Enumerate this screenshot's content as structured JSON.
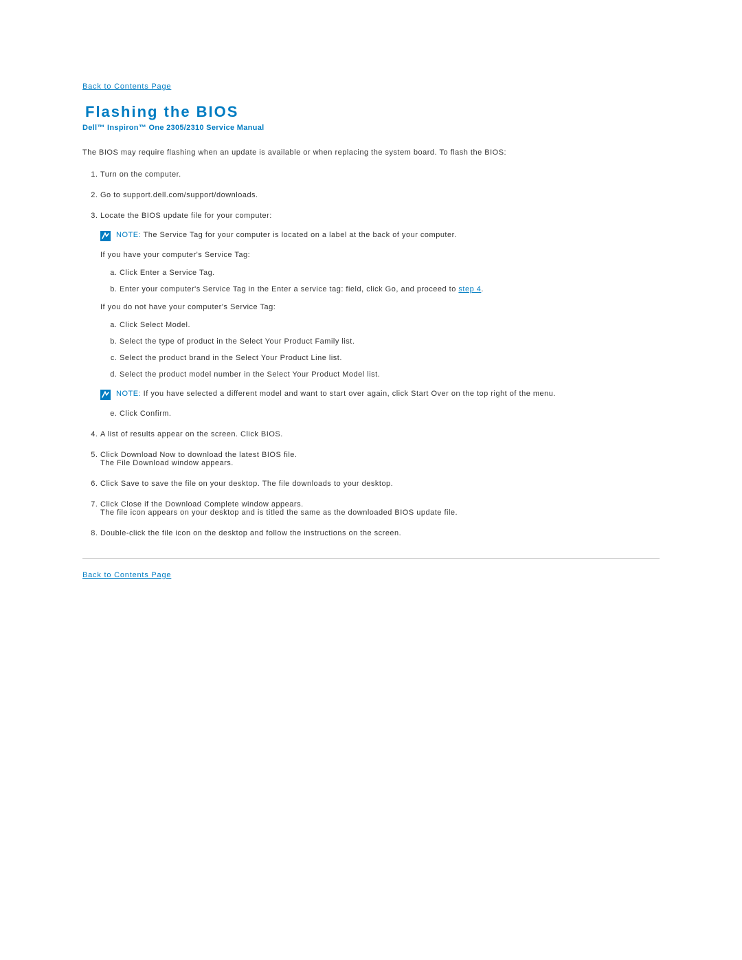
{
  "nav": {
    "backTop": "Back to Contents Page",
    "backBottom": "Back to Contents Page"
  },
  "title": "Flashing the BIOS",
  "subtitle": "Dell™ Inspiron™ One 2305/2310 Service Manual",
  "intro": "The BIOS may require flashing when an update is available or when replacing the system board. To flash the BIOS:",
  "steps": {
    "s1": "Turn on the computer.",
    "s2": "Go to support.dell.com/support/downloads.",
    "s3": "Locate the BIOS update file for your computer:",
    "s3_note_label": "NOTE:",
    "s3_note_text": " The Service Tag for your computer is located on a label at the back of your computer.",
    "s3_have": "If you have your computer's Service Tag:",
    "s3_have_a": "Click Enter a Service Tag.",
    "s3_have_b_pre": "Enter your computer's Service Tag in the Enter a service tag: field, click Go, and proceed to ",
    "s3_have_b_link": "step 4",
    "s3_have_b_post": ".",
    "s3_not": "If you do not have your computer's Service Tag:",
    "s3_not_a": "Click Select Model.",
    "s3_not_b": "Select the type of product in the Select Your Product Family list.",
    "s3_not_c": "Select the product brand in the Select Your Product Line list.",
    "s3_not_d": "Select the product model number in the Select Your Product Model list.",
    "s3_not_note_label": "NOTE:",
    "s3_not_note_text": " If you have selected a different model and want to start over again, click Start Over on the top right of the menu.",
    "s3_not_e": "Click Confirm.",
    "s4": "A list of results appear on the screen. Click BIOS.",
    "s5_line1": "Click Download Now to download the latest BIOS file.",
    "s5_line2": "The File Download window appears.",
    "s6": "Click Save to save the file on your desktop. The file downloads to your desktop.",
    "s7_line1": "Click Close if the Download Complete window appears.",
    "s7_line2": "The file icon appears on your desktop and is titled the same as the downloaded BIOS update file.",
    "s8": "Double-click the file icon on the desktop and follow the instructions on the screen."
  }
}
